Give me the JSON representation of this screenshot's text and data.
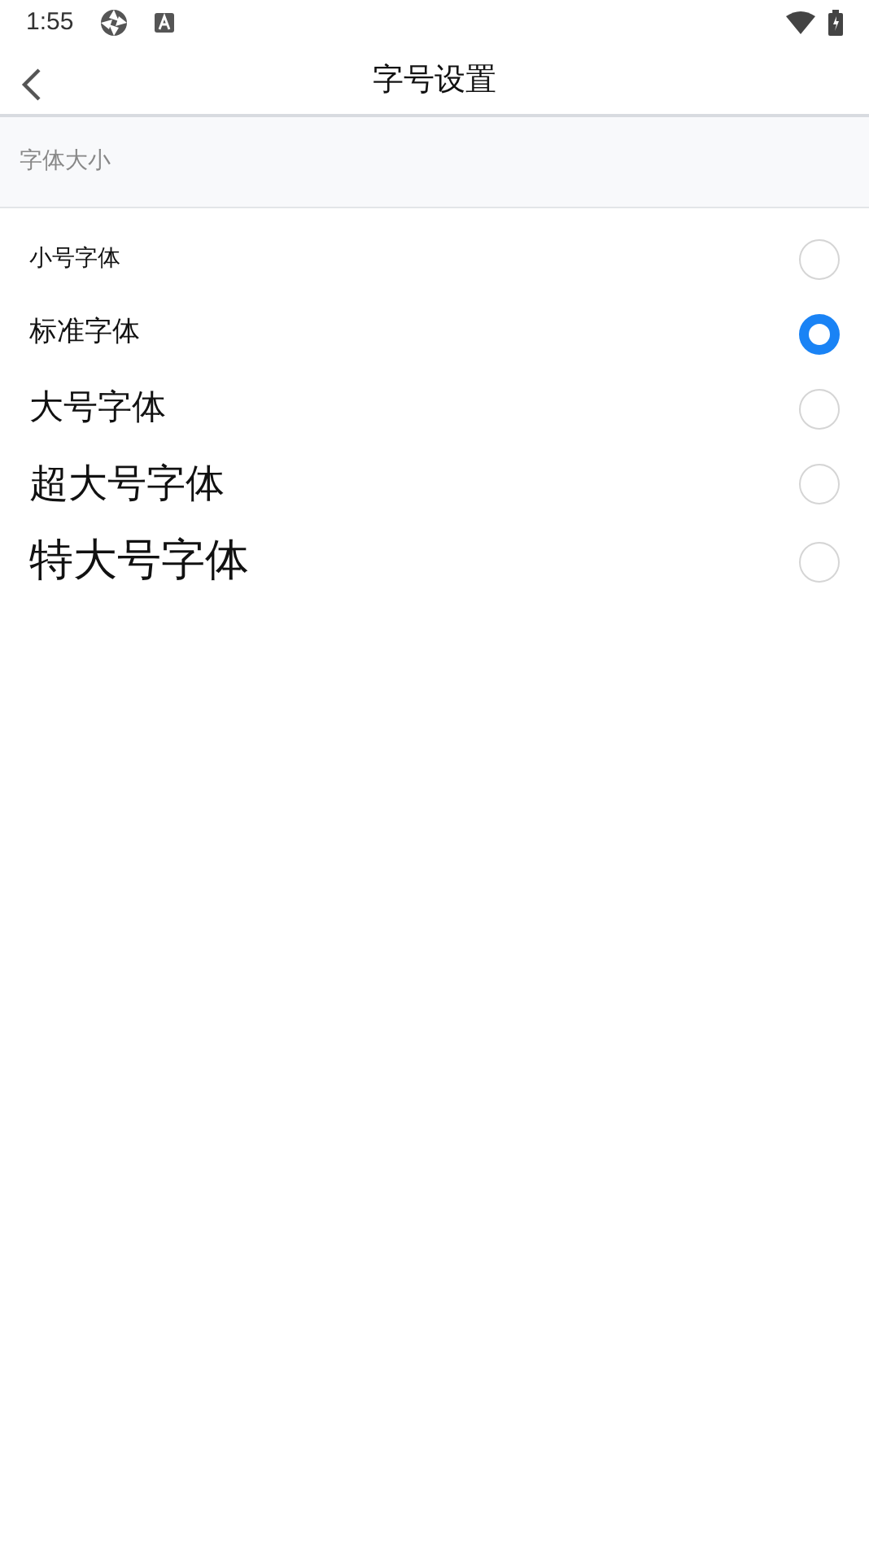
{
  "status_bar": {
    "time": "1:55"
  },
  "header": {
    "title": "字号设置"
  },
  "section": {
    "title": "字体大小"
  },
  "options": [
    {
      "label": "小号字体",
      "selected": false
    },
    {
      "label": "标准字体",
      "selected": true
    },
    {
      "label": "大号字体",
      "selected": false
    },
    {
      "label": "超大号字体",
      "selected": false
    },
    {
      "label": "特大号字体",
      "selected": false
    }
  ]
}
